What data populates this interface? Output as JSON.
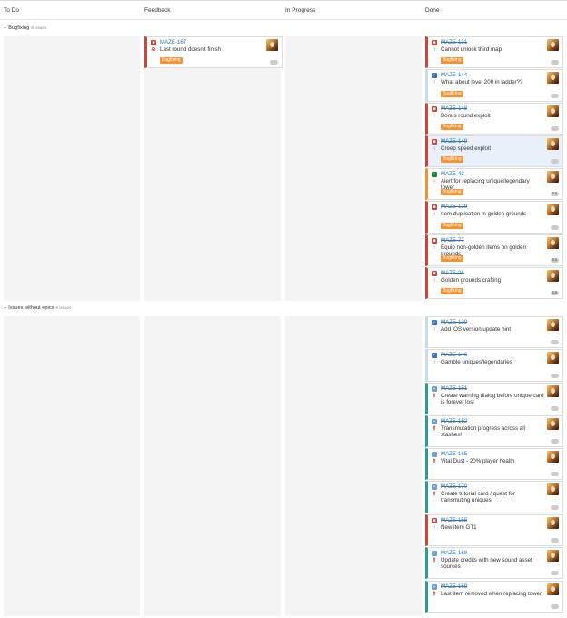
{
  "columns": [
    {
      "id": "todo",
      "title": "To Do"
    },
    {
      "id": "feedback",
      "title": "Feedback"
    },
    {
      "id": "inprogress",
      "title": "In Progress"
    },
    {
      "id": "done",
      "title": "Done"
    }
  ],
  "colors": {
    "bug_red": "#d04437",
    "improvement_green": "#14892c",
    "task_blue": "#4a6785",
    "story_blue": "#3b73af",
    "epic_orange": "#f79232",
    "link": "#3572b0",
    "lane_bg": "#f4f4f4"
  },
  "swimlanes": [
    {
      "name": "Bugfixing",
      "count_label": "8 issues",
      "twisty": "−",
      "feedback": [
        {
          "key": "MAZE-167",
          "summary": "Last round doesn't finish",
          "type": "bug",
          "priority": "blocker",
          "epic": "Bugfixing",
          "estimate": "",
          "done": false,
          "highlight": false,
          "border": "#d04437"
        }
      ],
      "done": [
        {
          "key": "MAZE-131",
          "summary": "Cannot unlock third map",
          "type": "bug",
          "priority": "major",
          "epic": "Bugfixing",
          "estimate": "",
          "done": true,
          "highlight": false,
          "border": "#d04437"
        },
        {
          "key": "MAZE-144",
          "summary": "What about level 200 in ladder??",
          "type": "task",
          "priority": "major",
          "epic": "Bugfixing",
          "estimate": "",
          "done": true,
          "highlight": false,
          "border": "#c8daf0"
        },
        {
          "key": "MAZE-148",
          "summary": "Bonus round exploit",
          "type": "bug",
          "priority": "major",
          "epic": "Bugfixing",
          "estimate": "",
          "done": true,
          "highlight": false,
          "border": "#d04437"
        },
        {
          "key": "MAZE-149",
          "summary": "Creep speed exploit",
          "type": "bug",
          "priority": "major",
          "epic": "Bugfixing",
          "estimate": "",
          "done": true,
          "highlight": true,
          "border": "#d04437"
        },
        {
          "key": "MAZE-42",
          "summary": "Alert for replacing unique/legendary tower",
          "type": "improvement",
          "priority": "major",
          "epic": "Bugfixing",
          "estimate": "0.5",
          "done": true,
          "highlight": false,
          "border": "#f79232"
        },
        {
          "key": "MAZE-129",
          "summary": "Item duplication in golden grounds",
          "type": "bug",
          "priority": "major",
          "epic": "Bugfixing",
          "estimate": "",
          "done": true,
          "highlight": false,
          "border": "#d04437"
        },
        {
          "key": "MAZE-77",
          "summary": "Equip non-golden items on golden grounds",
          "type": "bug",
          "priority": "major",
          "epic": "Bugfixing",
          "estimate": "0.5",
          "done": true,
          "highlight": false,
          "border": "#d04437"
        },
        {
          "key": "MAZE-26",
          "summary": "Golden grounds crafting",
          "type": "bug",
          "priority": "minor",
          "epic": "Bugfixing",
          "estimate": "0.5",
          "done": true,
          "highlight": false,
          "border": "#d04437"
        }
      ]
    },
    {
      "name": "Issues without epics",
      "count_label": "9 issues",
      "twisty": "−",
      "feedback": [],
      "done": [
        {
          "key": "MAZE-139",
          "summary": "Add iOS version update hint",
          "type": "task",
          "priority": "major",
          "epic": "",
          "estimate": "",
          "done": true,
          "highlight": false,
          "border": "#c8daf0"
        },
        {
          "key": "MAZE-146",
          "summary": "Gamble uniques/legendaries",
          "type": "task",
          "priority": "major",
          "epic": "",
          "estimate": "",
          "done": true,
          "highlight": false,
          "border": "#c8daf0"
        },
        {
          "key": "MAZE-151",
          "summary": "Create warning dialog before unique card is forever lost",
          "type": "story",
          "priority": "critical",
          "epic": "",
          "estimate": "",
          "done": true,
          "highlight": false,
          "border": "#2c9e8f"
        },
        {
          "key": "MAZE-152",
          "summary": "Transmutation progress across all stashes!",
          "type": "story",
          "priority": "critical",
          "epic": "",
          "estimate": "",
          "done": true,
          "highlight": false,
          "border": "#2c9e8f"
        },
        {
          "key": "MAZE-165",
          "summary": "Vital Dust - 20% player health",
          "type": "story",
          "priority": "critical",
          "epic": "",
          "estimate": "",
          "done": true,
          "highlight": false,
          "border": "#2c9e8f"
        },
        {
          "key": "MAZE-170",
          "summary": "Create tutorial card / quest for transmuting uniques",
          "type": "story",
          "priority": "critical",
          "epic": "",
          "estimate": "",
          "done": true,
          "highlight": false,
          "border": "#2c9e8f"
        },
        {
          "key": "MAZE-155",
          "summary": "New item GT1",
          "type": "bug",
          "priority": "major",
          "epic": "",
          "estimate": "",
          "done": true,
          "highlight": false,
          "border": "#d04437"
        },
        {
          "key": "MAZE-168",
          "summary": "Update credits with new sound asset sources",
          "type": "story",
          "priority": "critical",
          "epic": "",
          "estimate": "",
          "done": true,
          "highlight": false,
          "border": "#2c9e8f"
        },
        {
          "key": "MAZE-169",
          "summary": "Last item removed when replacing tower",
          "type": "story",
          "priority": "critical",
          "epic": "",
          "estimate": "",
          "done": true,
          "highlight": false,
          "border": "#2c9e8f"
        }
      ]
    }
  ]
}
